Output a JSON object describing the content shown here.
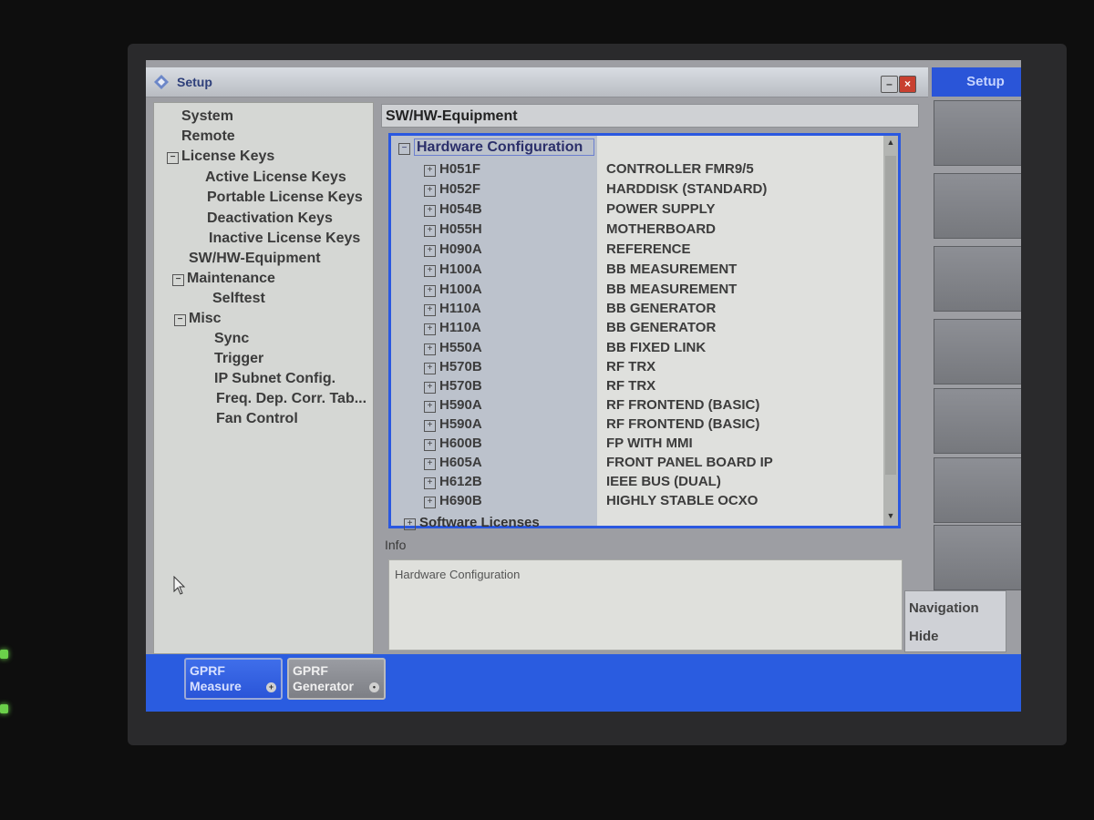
{
  "window": {
    "title": "Setup"
  },
  "softkeys": {
    "title": "Setup",
    "navigation": "Navigation",
    "hide": "Hide"
  },
  "nav_tree": [
    {
      "label": "System",
      "expander": ""
    },
    {
      "label": "Remote",
      "expander": ""
    },
    {
      "label": "License Keys",
      "expander": "−"
    },
    {
      "label": "Active License Keys",
      "expander": ""
    },
    {
      "label": "Portable License Keys",
      "expander": ""
    },
    {
      "label": "Deactivation Keys",
      "expander": ""
    },
    {
      "label": "Inactive License Keys",
      "expander": ""
    },
    {
      "label": "SW/HW-Equipment",
      "expander": ""
    },
    {
      "label": "Maintenance",
      "expander": "−"
    },
    {
      "label": "Selftest",
      "expander": ""
    },
    {
      "label": "Misc",
      "expander": "−"
    },
    {
      "label": "Sync",
      "expander": ""
    },
    {
      "label": "Trigger",
      "expander": ""
    },
    {
      "label": "IP Subnet Config.",
      "expander": ""
    },
    {
      "label": "Freq. Dep. Corr. Tab...",
      "expander": ""
    },
    {
      "label": "Fan Control",
      "expander": ""
    }
  ],
  "panel": {
    "header": "SW/HW-Equipment",
    "root_label": "Hardware Configuration",
    "hardware": [
      {
        "code": "H051F",
        "desc": "CONTROLLER FMR9/5"
      },
      {
        "code": "H052F",
        "desc": "HARDDISK (STANDARD)"
      },
      {
        "code": "H054B",
        "desc": "POWER SUPPLY"
      },
      {
        "code": "H055H",
        "desc": "MOTHERBOARD"
      },
      {
        "code": "H090A",
        "desc": "REFERENCE"
      },
      {
        "code": "H100A",
        "desc": "BB MEASUREMENT"
      },
      {
        "code": "H100A",
        "desc": "BB MEASUREMENT"
      },
      {
        "code": "H110A",
        "desc": "BB GENERATOR"
      },
      {
        "code": "H110A",
        "desc": "BB GENERATOR"
      },
      {
        "code": "H550A",
        "desc": "BB FIXED LINK"
      },
      {
        "code": "H570B",
        "desc": "RF TRX"
      },
      {
        "code": "H570B",
        "desc": "RF TRX"
      },
      {
        "code": "H590A",
        "desc": "RF FRONTEND (BASIC)"
      },
      {
        "code": "H590A",
        "desc": "RF FRONTEND (BASIC)"
      },
      {
        "code": "H600B",
        "desc": "FP WITH MMI"
      },
      {
        "code": "H605A",
        "desc": "FRONT PANEL BOARD IP"
      },
      {
        "code": "H612B",
        "desc": "IEEE BUS (DUAL)"
      },
      {
        "code": "H690B",
        "desc": "HIGHLY STABLE OCXO"
      }
    ],
    "software_label": "Software Licenses",
    "info_label": "Info",
    "info_text": "Hardware Configuration"
  },
  "taskbar": {
    "measure": {
      "line1": "GPRF",
      "line2": "Measure"
    },
    "generator": {
      "line1": "GPRF",
      "line2": "Generator"
    }
  },
  "colors": {
    "accent": "#2a58e0",
    "screen_bg": "#9d9ea3"
  }
}
